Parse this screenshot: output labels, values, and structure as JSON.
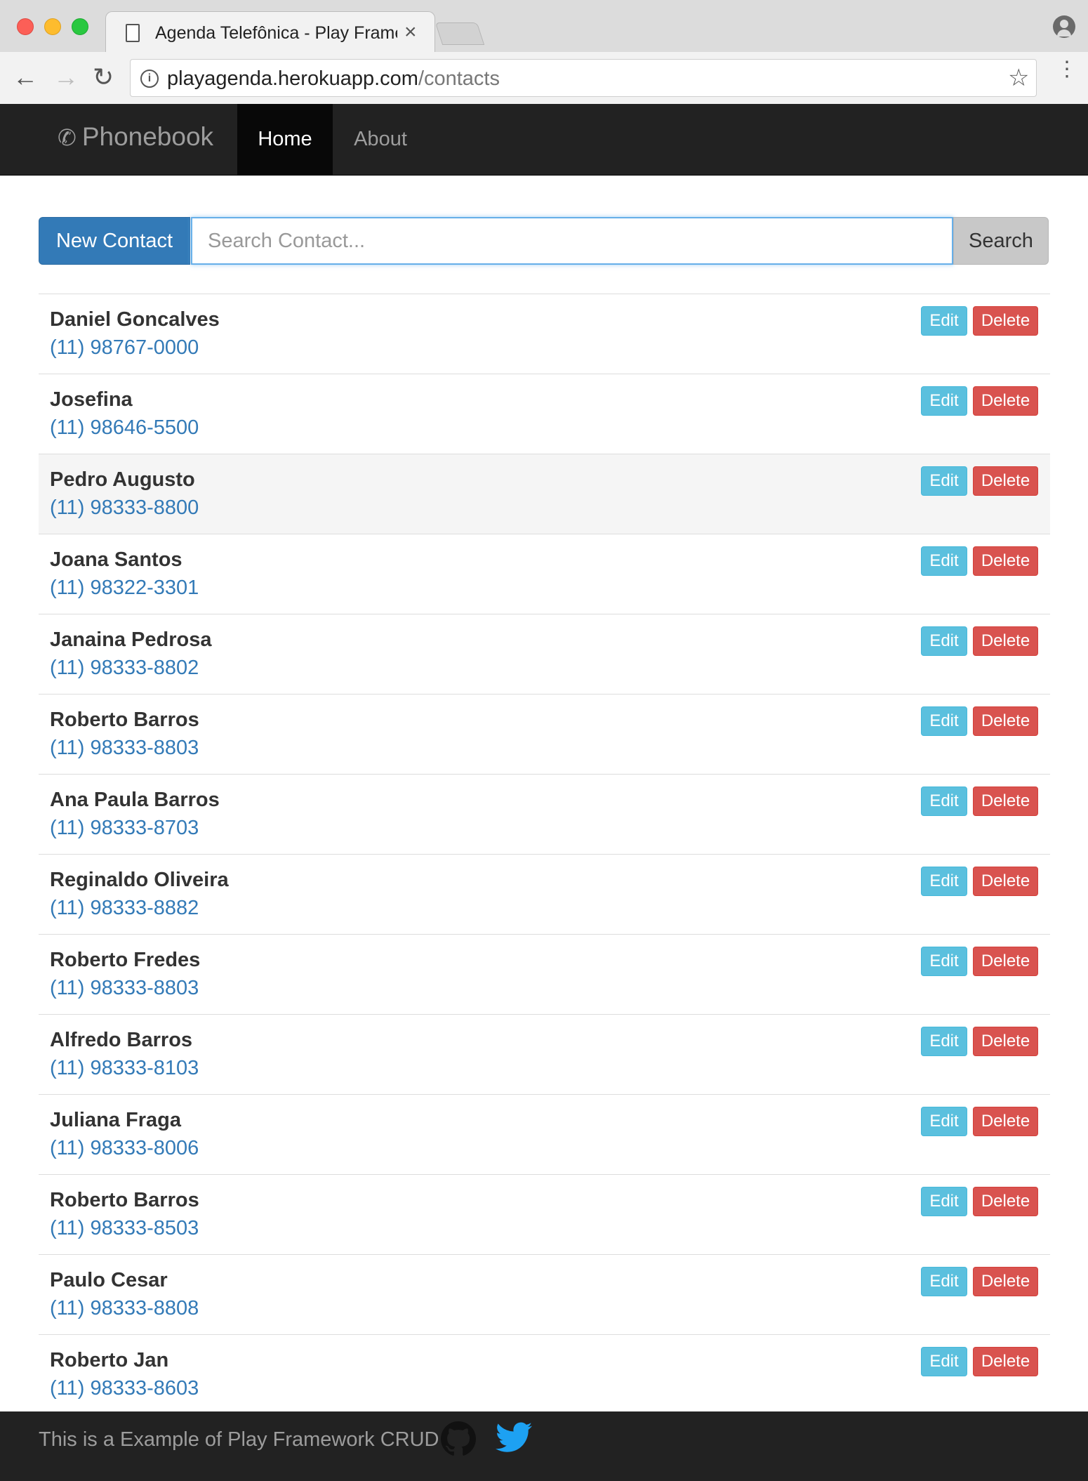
{
  "browser": {
    "tab_title": "Agenda Telefônica - Play Framework",
    "tab_close": "×",
    "url_host": "playagenda.herokuapp.com",
    "url_path": "/contacts",
    "icons": [
      "tab-document-icon",
      "back-arrow-icon",
      "forward-arrow-icon",
      "reload-icon",
      "info-icon",
      "star-icon",
      "menu-icon",
      "profile-icon"
    ]
  },
  "navbar": {
    "brand": "Phonebook",
    "brand_icon": "phone-icon",
    "home": "Home",
    "about": "About"
  },
  "search": {
    "new_contact_label": "New Contact",
    "placeholder": "Search Contact...",
    "value": "",
    "search_label": "Search"
  },
  "contacts": [
    {
      "name": "Daniel Goncalves",
      "phone": "(11) 98767-0000",
      "edit": "Edit",
      "delete": "Delete"
    },
    {
      "name": "Josefina",
      "phone": "(11) 98646-5500",
      "edit": "Edit",
      "delete": "Delete"
    },
    {
      "name": "Pedro Augusto",
      "phone": "(11) 98333-8800",
      "edit": "Edit",
      "delete": "Delete"
    },
    {
      "name": "Joana Santos",
      "phone": "(11) 98322-3301",
      "edit": "Edit",
      "delete": "Delete"
    },
    {
      "name": "Janaina Pedrosa",
      "phone": "(11) 98333-8802",
      "edit": "Edit",
      "delete": "Delete"
    },
    {
      "name": "Roberto Barros",
      "phone": "(11) 98333-8803",
      "edit": "Edit",
      "delete": "Delete"
    },
    {
      "name": "Ana Paula Barros",
      "phone": "(11) 98333-8703",
      "edit": "Edit",
      "delete": "Delete"
    },
    {
      "name": "Reginaldo Oliveira",
      "phone": "(11) 98333-8882",
      "edit": "Edit",
      "delete": "Delete"
    },
    {
      "name": "Roberto Fredes",
      "phone": "(11) 98333-8803",
      "edit": "Edit",
      "delete": "Delete"
    },
    {
      "name": "Alfredo Barros",
      "phone": "(11) 98333-8103",
      "edit": "Edit",
      "delete": "Delete"
    },
    {
      "name": "Juliana Fraga",
      "phone": "(11) 98333-8006",
      "edit": "Edit",
      "delete": "Delete"
    },
    {
      "name": "Roberto Barros",
      "phone": "(11) 98333-8503",
      "edit": "Edit",
      "delete": "Delete"
    },
    {
      "name": "Paulo Cesar",
      "phone": "(11) 98333-8808",
      "edit": "Edit",
      "delete": "Delete"
    },
    {
      "name": "Roberto Jan",
      "phone": "(11) 98333-8603",
      "edit": "Edit",
      "delete": "Delete"
    }
  ],
  "footer": {
    "text": "This is a Example of Play Framework CRUD",
    "icons": [
      "github-icon",
      "twitter-icon"
    ]
  },
  "colors": {
    "primary": "#337ab7",
    "info": "#5bc0de",
    "danger": "#d9534f",
    "navbar": "#222222"
  }
}
